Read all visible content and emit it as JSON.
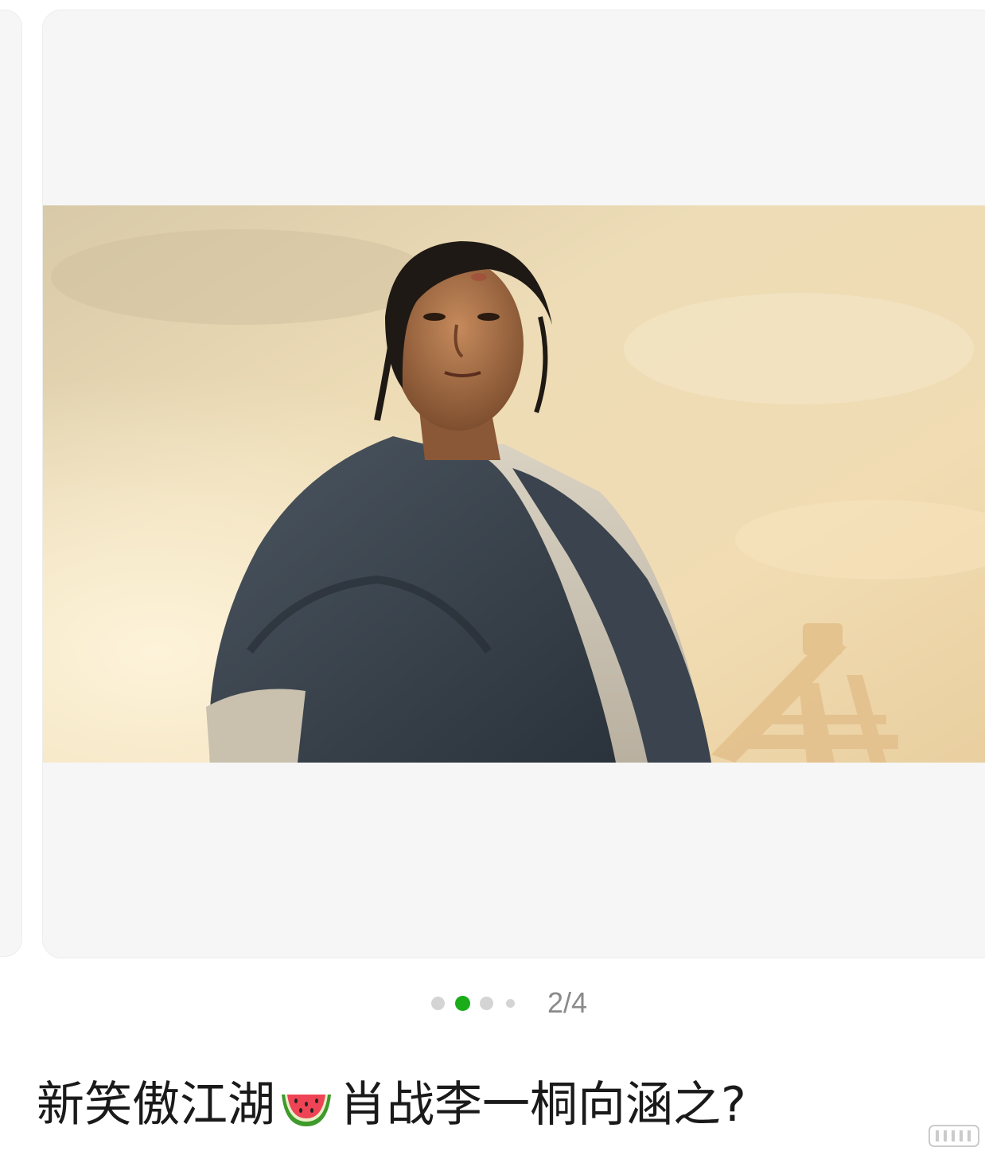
{
  "carousel": {
    "current_index": 2,
    "total": 4,
    "counter_text": "2/4",
    "active_dot_color": "#1aad19",
    "inactive_dot_color": "#d4d4d4"
  },
  "post": {
    "title_part1": "新笑傲江湖",
    "title_icon": "watermelon-icon",
    "title_part2": "肖战李一桐向涵之?"
  }
}
